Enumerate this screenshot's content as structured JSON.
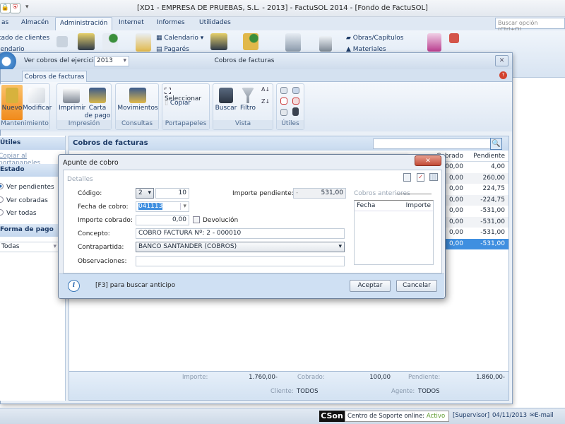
{
  "window": {
    "title": "[XD1 - EMPRESA DE PRUEBAS, S.L. - 2013] - FactuSOL 2014 - [Fondo de FactuSOL]"
  },
  "main_tabs": [
    {
      "label": "as"
    },
    {
      "label": "Almacén"
    },
    {
      "label": "Administración",
      "active": true
    },
    {
      "label": "Internet"
    },
    {
      "label": "Informes"
    },
    {
      "label": "Utilidades"
    }
  ],
  "search": {
    "placeholder": "Buscar opción (Ctrl+O)"
  },
  "main_ribbon": {
    "items": [
      "tado de clientes",
      "lendario",
      "Calendario",
      "Pagarés",
      "Obras/Capítulos",
      "Materiales"
    ]
  },
  "child": {
    "title": "Cobros de facturas",
    "ejercicio_label": "Ver cobros del ejercicio:",
    "ejercicio_value": "2013",
    "tab": "Cobros de facturas",
    "ribbon": {
      "groups": [
        {
          "label": "Mantenimiento",
          "buttons": [
            "Nuevo",
            "Modificar"
          ]
        },
        {
          "label": "Impresión",
          "buttons": [
            "Imprimir",
            "Carta de pago"
          ]
        },
        {
          "label": "Consultas",
          "buttons": [
            "Movimientos"
          ]
        },
        {
          "label": "Portapapeles",
          "buttons": [
            "Seleccionar",
            "Copiar"
          ]
        },
        {
          "label": "Vista",
          "buttons": [
            "Buscar",
            "Filtro"
          ]
        },
        {
          "label": "Útiles"
        }
      ]
    },
    "left": {
      "utiles_header": "Útiles",
      "copy_link": "Copiar al portapapeles",
      "estado_header": "Estado",
      "radios": [
        {
          "label": "Ver pendientes",
          "checked": true
        },
        {
          "label": "Ver cobradas"
        },
        {
          "label": "Ver todas"
        }
      ],
      "forma_header": "Forma de pago",
      "forma_value": "Todas"
    },
    "grid": {
      "title": "Cobros de facturas",
      "columns": [
        "Cobrado",
        "Pendiente"
      ],
      "rows": [
        {
          "cobrado": "100,00",
          "pendiente": "4,00"
        },
        {
          "cobrado": "0,00",
          "pendiente": "260,00"
        },
        {
          "cobrado": "0,00",
          "pendiente": "224,75"
        },
        {
          "cobrado": "0,00",
          "pendiente": "-224,75"
        },
        {
          "cobrado": "0,00",
          "pendiente": "-531,00"
        },
        {
          "cobrado": "0,00",
          "pendiente": "-531,00"
        },
        {
          "cobrado": "0,00",
          "pendiente": "-531,00"
        },
        {
          "cobrado": "0,00",
          "pendiente": "-531,00",
          "selected": true
        }
      ],
      "footer": {
        "importe_label": "Importe:",
        "importe": "1.760,00-",
        "cobrado_label": "Cobrado:",
        "cobrado": "100,00",
        "pendiente_label": "Pendiente:",
        "pendiente": "1.860,00-",
        "cliente_label": "Cliente:",
        "cliente": "TODOS",
        "agente_label": "Agente:",
        "agente": "TODOS"
      }
    }
  },
  "dialog": {
    "title": "Apunte de cobro",
    "section": "Detalles",
    "codigo_label": "Código:",
    "codigo_serie": "2",
    "codigo_num": "10",
    "importe_pendiente_label": "Importe pendiente:",
    "importe_pendiente": "531,00",
    "importe_pendiente_prefix": "-",
    "fecha_label": "Fecha de cobro:",
    "fecha": "041113",
    "importe_cobrado_label": "Importe cobrado:",
    "importe_cobrado": "0,00",
    "devolucion_label": "Devolución",
    "concepto_label": "Concepto:",
    "concepto": "COBRO FACTURA Nº: 2 - 000010",
    "contrapartida_label": "Contrapartida:",
    "contrapartida": "BANCO SANTANDER (COBROS)",
    "observaciones_label": "Observaciones:",
    "observaciones": "",
    "cobros_anteriores": "Cobros anteriores",
    "cobros_cols": [
      "Fecha",
      "Importe"
    ],
    "hint": "[F3] para buscar anticipo",
    "accept": "Aceptar",
    "cancel": "Cancelar"
  },
  "status": {
    "cson": "CSon",
    "soporte_label": "Centro de Soporte online:",
    "soporte_state": "Activo",
    "user": "[Supervisor]",
    "date": "04/11/2013",
    "email": "E-mail"
  },
  "colors": {
    "accent": "#3f8fe0",
    "ribbon": "#dbe5f1",
    "nuevo_active": "#f7a23c",
    "activo": "#5c9a2c"
  }
}
